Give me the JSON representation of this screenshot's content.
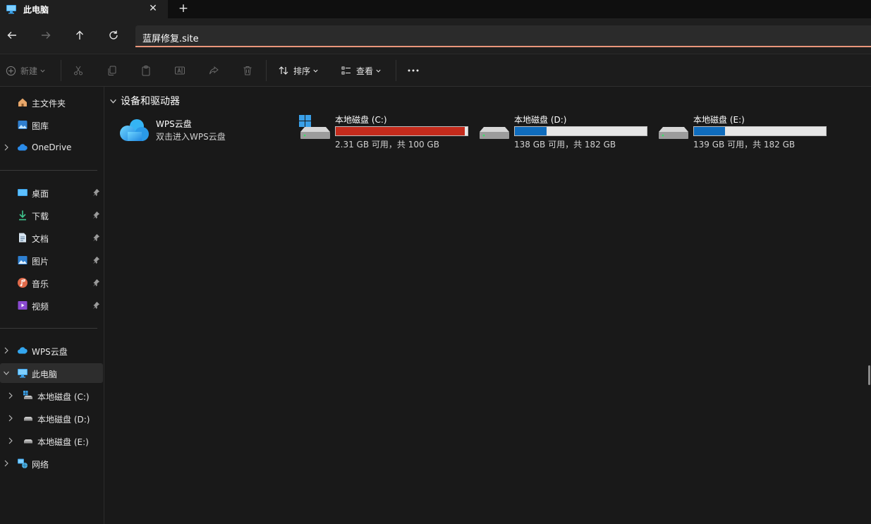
{
  "window": {
    "tab_title": "此电脑",
    "tab_icon": "computer-icon",
    "close_icon": "close-icon",
    "new_tab_icon": "plus-icon"
  },
  "address_bar": {
    "path": "蓝屏修复.site",
    "accent_color": "#e9967a"
  },
  "command_bar": {
    "new_label": "新建",
    "sort_label": "排序",
    "view_label": "查看",
    "more_icon": "more-icon"
  },
  "sidebar": {
    "top_items": [
      {
        "label": "主文件夹",
        "icon": "home-icon"
      },
      {
        "label": "图库",
        "icon": "gallery-icon"
      },
      {
        "label": "OneDrive",
        "icon": "onedrive-cloud-icon"
      }
    ],
    "pinned_items": [
      {
        "label": "桌面",
        "icon": "desktop-icon"
      },
      {
        "label": "下载",
        "icon": "download-icon"
      },
      {
        "label": "文档",
        "icon": "document-icon"
      },
      {
        "label": "图片",
        "icon": "picture-icon"
      },
      {
        "label": "音乐",
        "icon": "music-icon"
      },
      {
        "label": "视频",
        "icon": "video-icon"
      }
    ],
    "tree_items": [
      {
        "label": "WPS云盘",
        "icon": "wps-cloud-icon"
      },
      {
        "label": "此电脑",
        "icon": "computer-icon"
      },
      {
        "label": "本地磁盘 (C:)",
        "icon": "system-drive-icon"
      },
      {
        "label": "本地磁盘 (D:)",
        "icon": "drive-icon"
      },
      {
        "label": "本地磁盘 (E:)",
        "icon": "drive-icon"
      },
      {
        "label": "网络",
        "icon": "network-icon"
      }
    ]
  },
  "content": {
    "group_title": "设备和驱动器",
    "cloud": {
      "name": "WPS云盘",
      "subtitle": "双击进入WPS云盘"
    },
    "drives": [
      {
        "name": "本地磁盘 (C:)",
        "info": "2.31 GB 可用，共 100 GB",
        "used_fraction": 0.977,
        "bar_color": "#c42b1c",
        "system": true
      },
      {
        "name": "本地磁盘 (D:)",
        "info": "138 GB 可用，共 182 GB",
        "used_fraction": 0.242,
        "bar_color": "#0f6cbd",
        "system": false
      },
      {
        "name": "本地磁盘 (E:)",
        "info": "139 GB 可用，共 182 GB",
        "used_fraction": 0.236,
        "bar_color": "#0f6cbd",
        "system": false
      }
    ]
  }
}
